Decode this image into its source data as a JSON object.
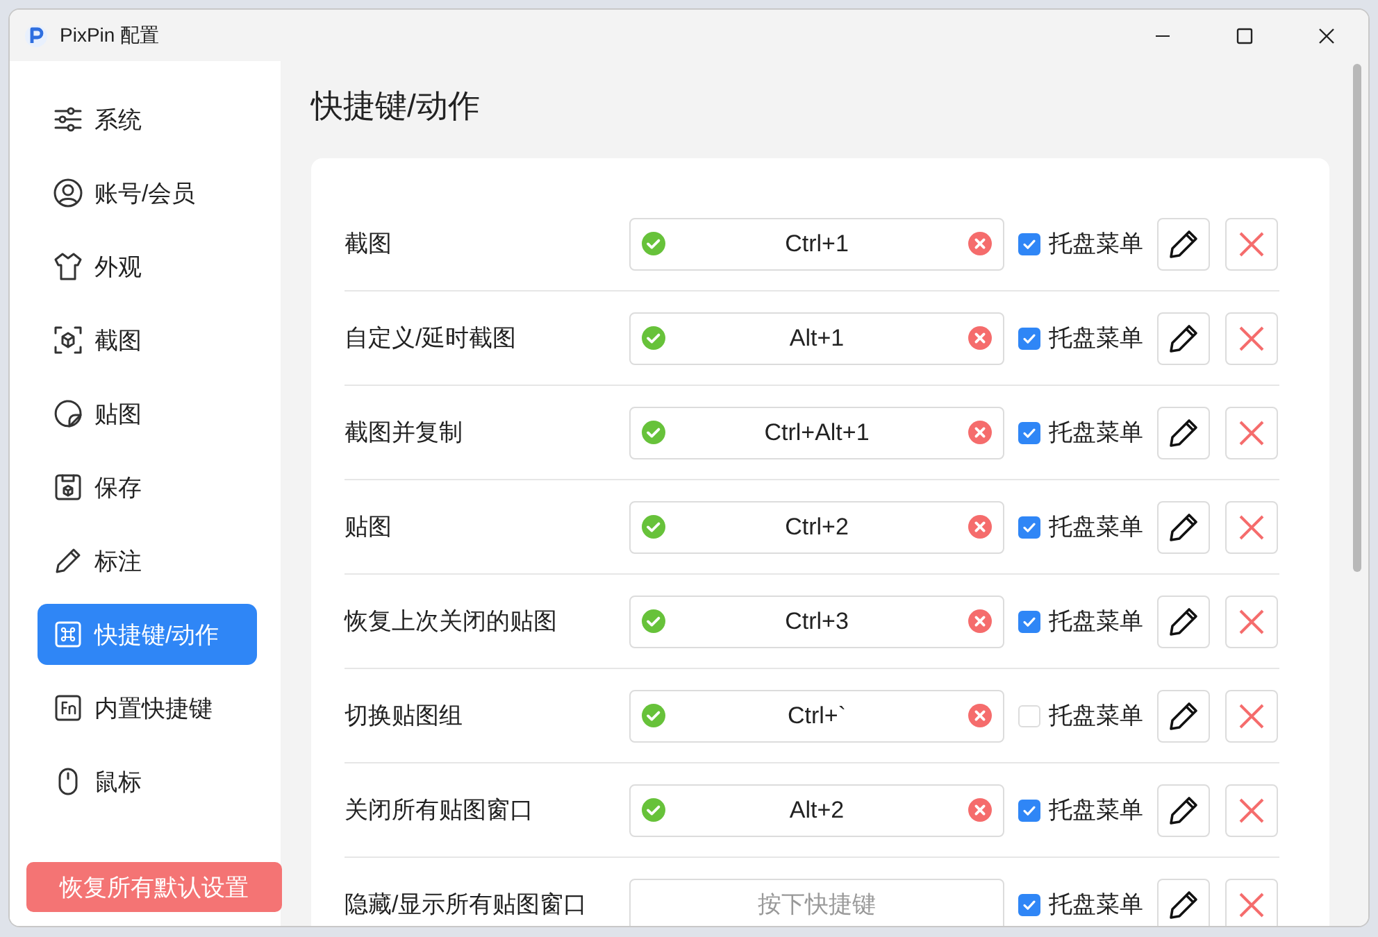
{
  "window": {
    "title": "PixPin 配置"
  },
  "sidebar": {
    "items": [
      {
        "label": "系统",
        "selected": false
      },
      {
        "label": "账号/会员",
        "selected": false
      },
      {
        "label": "外观",
        "selected": false
      },
      {
        "label": "截图",
        "selected": false
      },
      {
        "label": "贴图",
        "selected": false
      },
      {
        "label": "保存",
        "selected": false
      },
      {
        "label": "标注",
        "selected": false
      },
      {
        "label": "快捷键/动作",
        "selected": true
      },
      {
        "label": "内置快捷键",
        "selected": false
      },
      {
        "label": "鼠标",
        "selected": false
      }
    ],
    "reset_button": "恢复所有默认设置"
  },
  "main": {
    "heading": "快捷键/动作",
    "rows": [
      {
        "label": "截图",
        "shortcut": "Ctrl+1",
        "tray_menu": {
          "label": "托盘菜单",
          "checked": true
        }
      },
      {
        "label": "自定义/延时截图",
        "shortcut": "Alt+1",
        "tray_menu": {
          "label": "托盘菜单",
          "checked": true
        }
      },
      {
        "label": "截图并复制",
        "shortcut": "Ctrl+Alt+1",
        "tray_menu": {
          "label": "托盘菜单",
          "checked": true
        }
      },
      {
        "label": "贴图",
        "shortcut": "Ctrl+2",
        "tray_menu": {
          "label": "托盘菜单",
          "checked": true
        }
      },
      {
        "label": "恢复上次关闭的贴图",
        "shortcut": "Ctrl+3",
        "tray_menu": {
          "label": "托盘菜单",
          "checked": true
        }
      },
      {
        "label": "切换贴图组",
        "shortcut": "Ctrl+`",
        "tray_menu": {
          "label": "托盘菜单",
          "checked": false
        }
      },
      {
        "label": "关闭所有贴图窗口",
        "shortcut": "Alt+2",
        "tray_menu": {
          "label": "托盘菜单",
          "checked": true
        }
      },
      {
        "label": "隐藏/显示所有贴图窗口",
        "placeholder": "按下快捷键",
        "tray_menu": {
          "label": "托盘菜单",
          "checked": true
        }
      }
    ]
  }
}
